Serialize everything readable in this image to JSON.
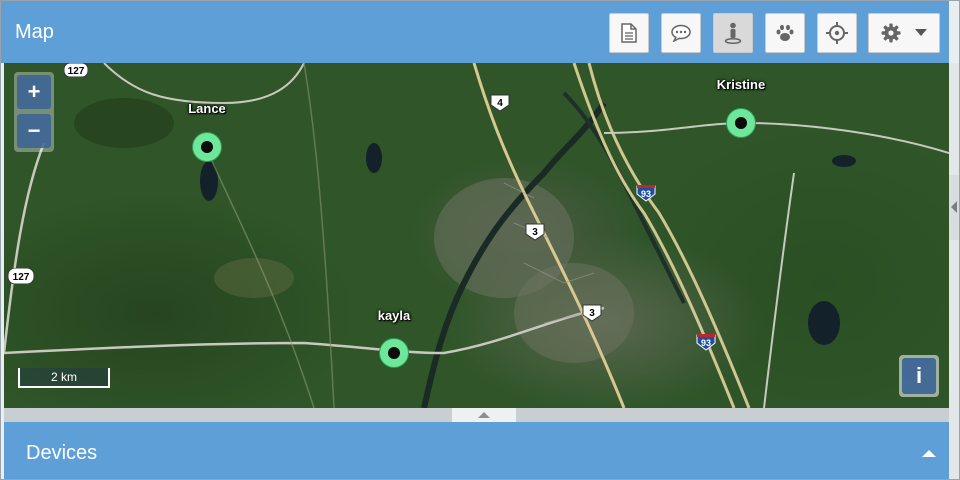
{
  "header": {
    "title": "Map",
    "toolbar": [
      {
        "name": "report-button",
        "icon": "document-icon"
      },
      {
        "name": "messages-button",
        "icon": "chat-icon"
      },
      {
        "name": "person-location-button",
        "icon": "person-pin-icon",
        "active": true
      },
      {
        "name": "pet-button",
        "icon": "paw-icon"
      },
      {
        "name": "locate-button",
        "icon": "crosshair-icon"
      },
      {
        "name": "settings-button",
        "icon": "gear-icon",
        "dropdown": true
      }
    ]
  },
  "map": {
    "zoom_in_label": "+",
    "zoom_out_label": "−",
    "scale_label": "2 km",
    "info_label": "i",
    "markers": [
      {
        "label": "Lance"
      },
      {
        "label": "kayla"
      },
      {
        "label": "Kristine"
      }
    ],
    "route_shields": [
      "127",
      "127",
      "4",
      "3",
      "3",
      "93",
      "93"
    ]
  },
  "devices": {
    "title": "Devices"
  },
  "colors": {
    "header_bg": "#5f9fd8",
    "marker_fill": "#6fe79a",
    "map_forest": "#2f5528"
  }
}
